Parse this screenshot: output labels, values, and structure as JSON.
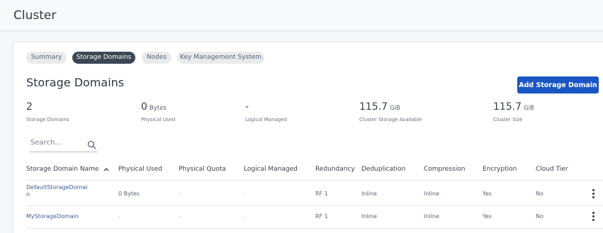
{
  "page": {
    "title": "Cluster"
  },
  "tabs": [
    {
      "label": "Summary",
      "active": false
    },
    {
      "label": "Storage Domains",
      "active": true
    },
    {
      "label": "Nodes",
      "active": false
    },
    {
      "label": "Key Management System",
      "active": false
    }
  ],
  "section": {
    "title": "Storage Domains",
    "add_button": "Add Storage Domain"
  },
  "stats": [
    {
      "value": "2",
      "unit": "",
      "label": "Storage Domains"
    },
    {
      "value": "0",
      "unit": "Bytes",
      "label": "Physical Used"
    },
    {
      "value": "-",
      "unit": "",
      "label": "Logical Managed"
    },
    {
      "value": "115.7",
      "unit": "GiB",
      "label": "Cluster Storage Available"
    },
    {
      "value": "115.7",
      "unit": "GiB",
      "label": "Cluster Size"
    }
  ],
  "search": {
    "placeholder": "Search..."
  },
  "table": {
    "sort_column": "Storage Domain Name",
    "sort_direction": "ascending",
    "columns": [
      "Storage Domain Name",
      "Physical Used",
      "Physical Quota",
      "Logical Managed",
      "Redundancy",
      "Deduplication",
      "Compression",
      "Encryption",
      "Cloud Tier"
    ],
    "rows": [
      {
        "name_line1": "DefaultStorageDomai",
        "name_line2": "n",
        "physical_used": "0 Bytes",
        "physical_quota": "-",
        "logical_managed": "-",
        "redundancy": "RF 1",
        "deduplication": "Inline",
        "compression": "Inline",
        "encryption": "Yes",
        "cloud_tier": "No"
      },
      {
        "name_line1": "MyStorageDomain",
        "name_line2": "",
        "physical_used": "-",
        "physical_quota": "-",
        "logical_managed": "-",
        "redundancy": "RF 1",
        "deduplication": "Inline",
        "compression": "Inline",
        "encryption": "Yes",
        "cloud_tier": "No"
      }
    ]
  },
  "colors": {
    "accent": "#1a56c2",
    "active_tab": "#3c4654",
    "link": "#3b5d8f"
  },
  "icons": {
    "search": "search-icon",
    "sort": "sort-ascending-icon",
    "row_menu": "more-vertical-icon"
  }
}
